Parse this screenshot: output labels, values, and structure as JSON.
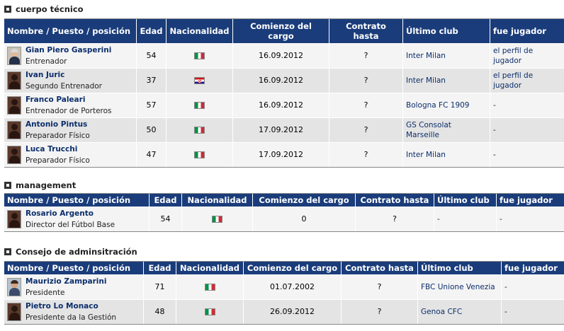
{
  "sections": [
    {
      "title": "cuerpo técnico",
      "headers": [
        "Nombre / Puesto / posición",
        "Edad",
        "Nacionalidad",
        "Comienzo del cargo",
        "Contrato hasta",
        "Último club",
        "fue jugador"
      ],
      "rows": [
        {
          "name": "Gian Piero Gasperini",
          "role": "Entrenador",
          "age": "54",
          "nationality": "Italia",
          "flag": "flag-italy",
          "start": "16.09.2012",
          "until": "?",
          "club": "Inter Milan",
          "player": "el perfil de jugador",
          "avatar": "photo"
        },
        {
          "name": "Ivan Juric",
          "role": "Segundo Entrenador",
          "age": "37",
          "nationality": "Croacia",
          "flag": "flag-croatia",
          "start": "16.09.2012",
          "until": "?",
          "club": "Inter Milan",
          "player": "el perfil de jugador",
          "avatar": "silhouette"
        },
        {
          "name": "Franco Paleari",
          "role": "Entrenador de Porteros",
          "age": "57",
          "nationality": "Italia",
          "flag": "flag-italy",
          "start": "16.09.2012",
          "until": "?",
          "club": "Bologna FC 1909",
          "player": "-",
          "avatar": "silhouette"
        },
        {
          "name": "Antonio Pintus",
          "role": "Preparador Físico",
          "age": "50",
          "nationality": "Italia",
          "flag": "flag-italy",
          "start": "17.09.2012",
          "until": "?",
          "club": "GS Consolat Marseille",
          "player": "-",
          "avatar": "silhouette"
        },
        {
          "name": "Luca Trucchi",
          "role": "Preparador Físico",
          "age": "47",
          "nationality": "Italia",
          "flag": "flag-italy",
          "start": "17.09.2012",
          "until": "?",
          "club": "Inter Milan",
          "player": "-",
          "avatar": "silhouette"
        }
      ]
    },
    {
      "title": "management",
      "headers": [
        "Nombre / Puesto / posición",
        "Edad",
        "Nacionalidad",
        "Comienzo del cargo",
        "Contrato hasta",
        "Último club",
        "fue jugador"
      ],
      "rows": [
        {
          "name": "Rosario Argento",
          "role": "Director del Fútbol Base",
          "age": "54",
          "nationality": "Italia",
          "flag": "flag-italy",
          "start": "0",
          "until": "?",
          "club": "-",
          "player": "-",
          "avatar": "silhouette"
        }
      ]
    },
    {
      "title": "Consejo de adminsitración",
      "headers": [
        "Nombre / Puesto / posición",
        "Edad",
        "Nacionalidad",
        "Comienzo del cargo",
        "Contrato hasta",
        "Último club",
        "fue jugador"
      ],
      "rows": [
        {
          "name": "Maurizio Zamparini",
          "role": "Presidente",
          "age": "71",
          "nationality": "Italia",
          "flag": "flag-italy",
          "start": "01.07.2002",
          "until": "?",
          "club": "FBC Unione Venezia",
          "player": "-",
          "avatar": "photo"
        },
        {
          "name": "Pietro Lo Monaco",
          "role": "Presidente da la Gestión",
          "age": "48",
          "nationality": "Italia",
          "flag": "flag-italy",
          "start": "26.09.2012",
          "until": "?",
          "club": "Genoa CFC",
          "player": "-",
          "avatar": "silhouette"
        }
      ]
    }
  ],
  "colors": {
    "header_bg": "#1a3c7a",
    "link": "#0b2e6b",
    "row_odd": "#f4f4f4",
    "row_even": "#e4e4e4"
  }
}
